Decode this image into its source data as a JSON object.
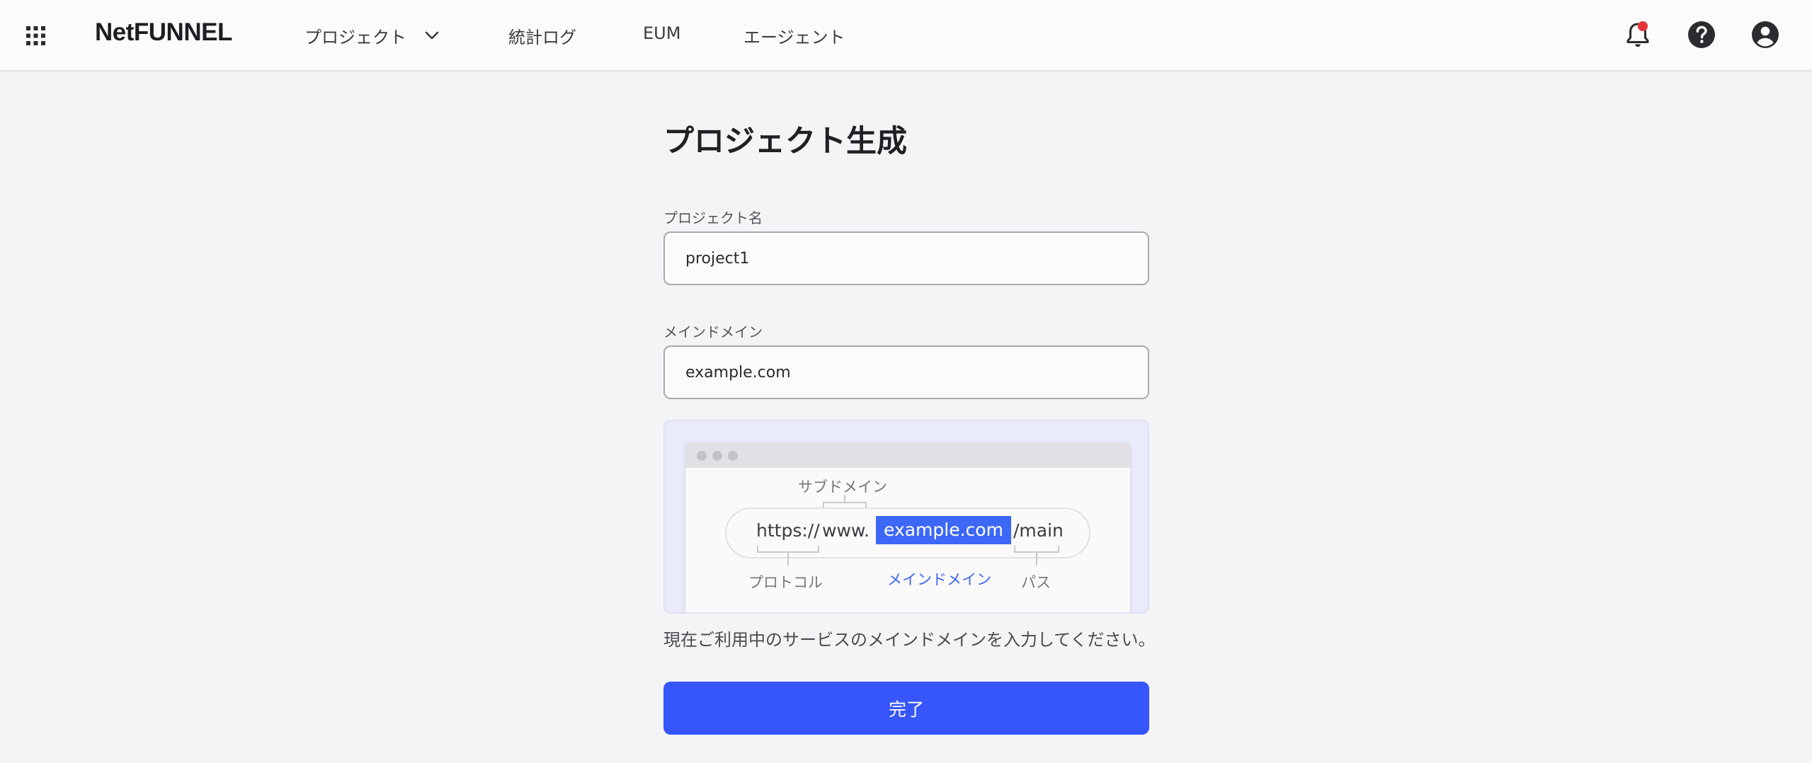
{
  "header": {
    "logo": "NetFUNNEL",
    "nav": {
      "project": "プロジェクト",
      "stats_log": "統計ログ",
      "eum": "EUM",
      "agent": "エージェント"
    },
    "icons": [
      "apps-grid-icon",
      "chevron-down-icon",
      "bell-icon",
      "help-icon",
      "account-icon"
    ],
    "notification_dot_color": "#e5343a"
  },
  "form": {
    "title": "プロジェクト生成",
    "project_name": {
      "label": "プロジェクト名",
      "value": "project1"
    },
    "main_domain": {
      "label": "メインドメイン",
      "value": "example.com"
    },
    "illustration": {
      "protocol": "https://",
      "subdomain": "www.",
      "domain": "example.com",
      "path": "/main",
      "labels": {
        "subdomain": "サブドメイン",
        "protocol": "プロトコル",
        "main_domain": "メインドメイン",
        "path": "パス"
      }
    },
    "help_text": "現在ご利用中のサービスのメインドメインを入力してください。",
    "submit_label": "完了"
  },
  "colors": {
    "accent": "#3656fb",
    "domain_highlight": "#3d67f5",
    "background": "#f4f4f6"
  }
}
